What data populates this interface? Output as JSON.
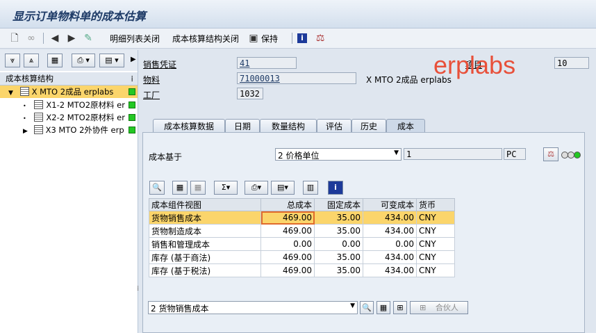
{
  "window": {
    "title": "显示订单物料单的成本估算"
  },
  "toolbar": {
    "detail_close": "明细列表关闭",
    "costing_close": "成本核算结构关闭",
    "keep": "保持"
  },
  "left": {
    "header": "成本核算结构",
    "items": [
      {
        "label": "X MTO 2成品 erplabs"
      },
      {
        "label": "X1-2 MTO2原材料 er"
      },
      {
        "label": "X2-2 MTO2原材料 er"
      },
      {
        "label": "X3 MTO 2外协件 erp"
      }
    ]
  },
  "header_fields": {
    "sales_doc_label": "销售凭证",
    "sales_doc": "41",
    "material_label": "物料",
    "material": "71000013",
    "material_desc": "X MTO 2成品 erplabs",
    "plant_label": "工厂",
    "plant": "1032",
    "item_label": "项目",
    "item": "10"
  },
  "watermark": "erplabs",
  "tabs": [
    "成本核算数据",
    "日期",
    "数量结构",
    "评估",
    "历史",
    "成本"
  ],
  "cost_basis": {
    "label": "成本基于",
    "value": "2 价格单位",
    "qty": "1",
    "unit": "PC"
  },
  "table": {
    "columns": [
      "成本组件视图",
      "总成本",
      "固定成本",
      "可变成本",
      "货币"
    ],
    "rows": [
      [
        "货物销售成本",
        "469.00",
        "35.00",
        "434.00",
        "CNY"
      ],
      [
        "货物制造成本",
        "469.00",
        "35.00",
        "434.00",
        "CNY"
      ],
      [
        "销售和管理成本",
        "0.00",
        "0.00",
        "0.00",
        "CNY"
      ],
      [
        "库存 (基于商法)",
        "469.00",
        "35.00",
        "434.00",
        "CNY"
      ],
      [
        "库存 (基于税法)",
        "469.00",
        "35.00",
        "434.00",
        "CNY"
      ]
    ]
  },
  "bottom": {
    "view_select": "2 货物销售成本",
    "partner_btn": "合伙人"
  },
  "colors": {
    "accent": "#fbd56b",
    "status_green": "#23c823",
    "watermark": "#e8503a"
  }
}
